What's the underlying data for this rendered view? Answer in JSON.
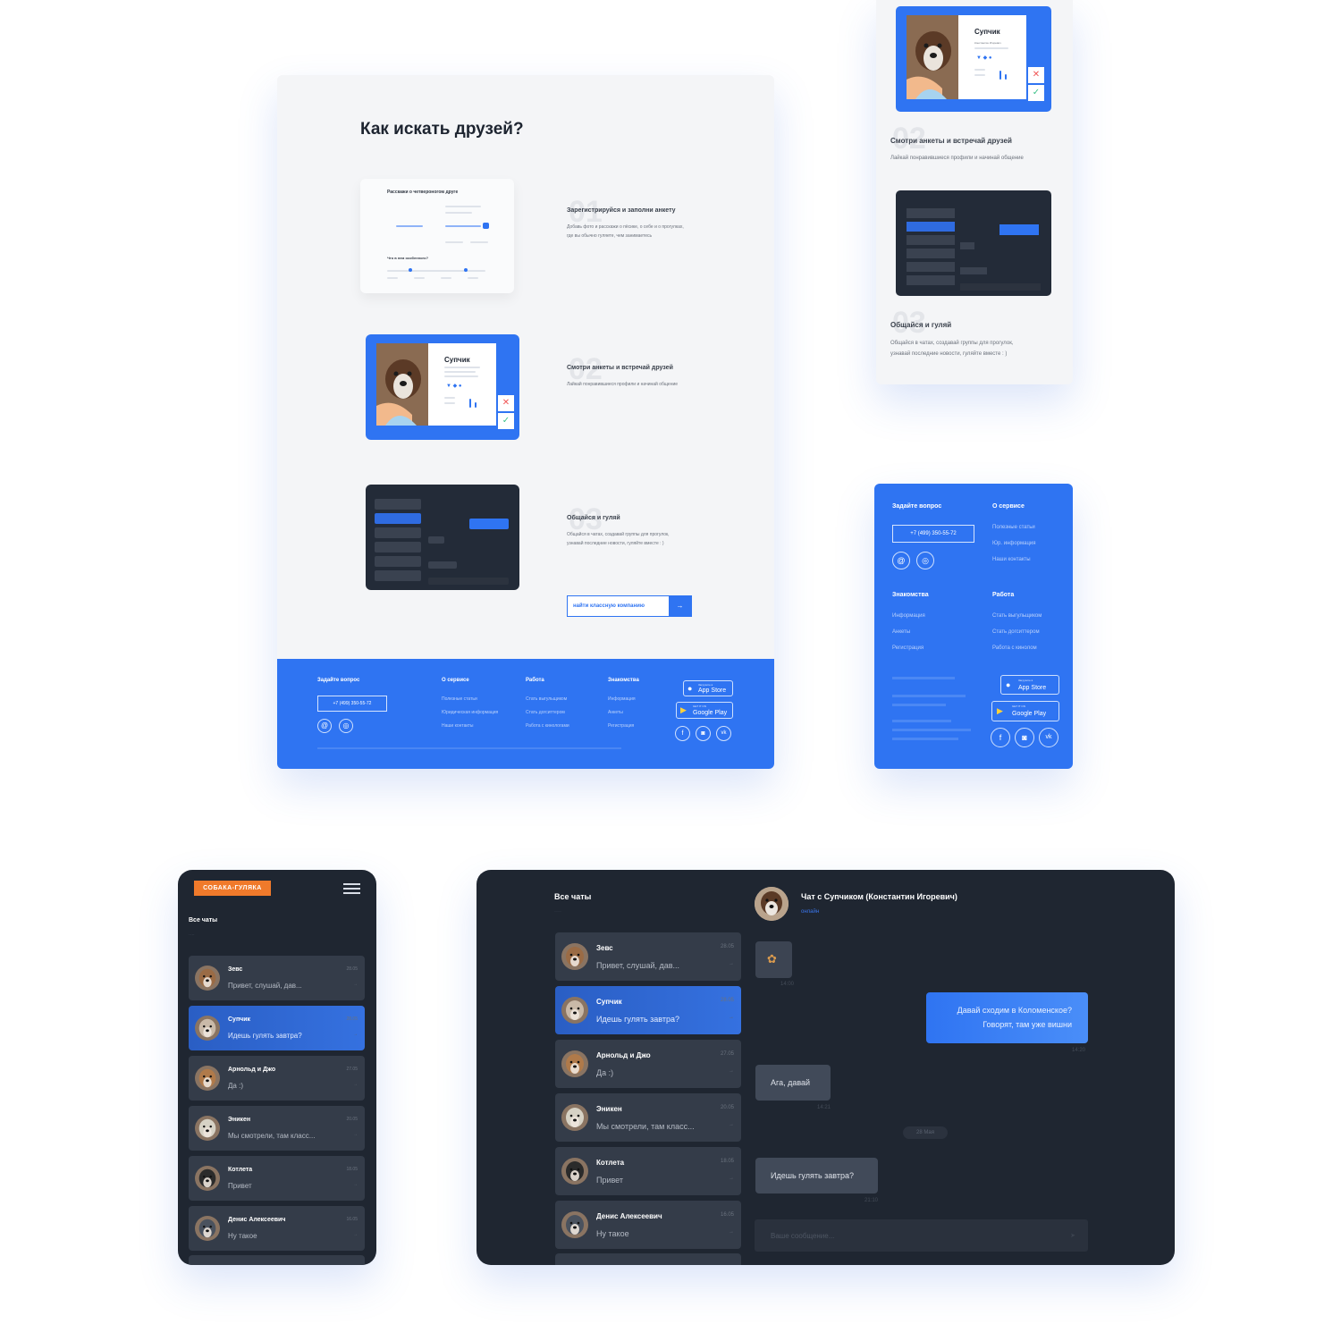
{
  "main_card": {
    "heading": "Как искать друзей?",
    "steps": [
      {
        "num": "01",
        "title": "Зарегистрируйся и заполни анкету",
        "desc": "Добавь фото и расскажи о пёсике, о себе и о прогулках, где вы обычно гуляете, чем занимаетесь",
        "thumb": {
          "title": "Расскажи о четвероногом друге",
          "subtitle": "Что в нем особенного?"
        }
      },
      {
        "num": "02",
        "title": "Смотри анкеты и встречай друзей",
        "desc": "Лайкай понравившиеся профили и начинай общение",
        "thumb": {
          "name": "Супчик"
        }
      },
      {
        "num": "03",
        "title": "Общайся и гуляй",
        "desc": "Общайся в чатах, создавай группы для прогулок, узнавай последние новости, гуляйте вместе : )"
      }
    ],
    "cta_label": "найти классную компанию",
    "cta_arrow": "→"
  },
  "footer": {
    "ask_title": "Задайте вопрос",
    "phone": "+7 (499) 350-55-72",
    "service_title": "О сервисе",
    "service_links": [
      "Полезные статьи",
      "Юридическая информация",
      "Наши контакты"
    ],
    "work_title": "Работа",
    "work_links": [
      "Стать выгульщиком",
      "Стать догситтером",
      "Работа с кинологами"
    ],
    "dating_title": "Знакомства",
    "dating_links": [
      "Информация",
      "Анкеты",
      "Регистрация"
    ],
    "app_store_small": "Загрузите в",
    "app_store": "App Store",
    "google_play_small": "GET IT ON",
    "google_play": "Google Play"
  },
  "right_column": {
    "step2_num": "02",
    "step2_title": "Смотри анкеты и встречай друзей",
    "step2_desc": "Лайкай понравившиеся профили и начинай общение",
    "step3_num": "03",
    "step3_title": "Общайся и гуляй",
    "step3_desc_1": "Общайся в чатах, создавай группы для прогулок,",
    "step3_desc_2": "узнавай последние новости, гуляйте вместе : )",
    "card_name": "Супчик",
    "card_sub": "Константин Игоревич"
  },
  "mobile_footer": {
    "ask_title": "Задайте вопрос",
    "phone": "+7 (499) 350-55-72",
    "service_title": "О сервисе",
    "service_links": [
      "Полезные статьи",
      "Юр. информация",
      "Наши контакты"
    ],
    "dating_title": "Знакомства",
    "dating_links": [
      "Информация",
      "Анкеты",
      "Регистрация"
    ],
    "work_title": "Работа",
    "work_links": [
      "Стать выгульщиком",
      "Стать догситтером",
      "Работа с кинолом"
    ],
    "app_store_small": "Загрузите в",
    "app_store": "App Store",
    "google_play_small": "GET IT ON",
    "google_play": "Google Play"
  },
  "mobile_chat": {
    "logo": "СОБАКА-ГУЛЯКА",
    "title": "Все чаты"
  },
  "chats": [
    {
      "name": "Зевс",
      "msg": "Привет, слушай, дав...",
      "date": "28.05",
      "active": false,
      "avatar": "#9a6b45"
    },
    {
      "name": "Супчик",
      "msg": "Идешь гулять завтра?",
      "date": "28.05",
      "active": true,
      "avatar": "#c9b9a8"
    },
    {
      "name": "Арнольд и Джо",
      "msg": "Да :)",
      "date": "27.05",
      "active": false,
      "avatar": "#b07a4a"
    },
    {
      "name": "Эникен",
      "msg": "Мы смотрели, там класс...",
      "date": "20.05",
      "active": false,
      "avatar": "#d6d2c5"
    },
    {
      "name": "Котлета",
      "msg": "Привет",
      "date": "18.05",
      "active": false,
      "avatar": "#2b2b2b"
    },
    {
      "name": "Денис Алексеевич",
      "msg": "Ну такое",
      "date": "16.05",
      "active": false,
      "avatar": "#4a525e"
    }
  ],
  "desktop_chat": {
    "title": "Все чаты",
    "chat_with": "Чат с Супчиком (Константин Игоревич)",
    "status": "онлайн",
    "messages": [
      {
        "dir": "out",
        "text_1": "Давай сходим в Коломенское?",
        "text_2": "Говорят, там уже вишни",
        "time": "14:20"
      },
      {
        "dir": "in",
        "text_1": "Ага, давай",
        "time": "14:21"
      },
      {
        "dir": "in",
        "text_1": "Идешь гулять завтра?",
        "time": "21:10"
      }
    ],
    "date_pill": "28 Мая",
    "sticker_time": "14:00",
    "input_placeholder": "Ваше сообщение..."
  },
  "colors": {
    "brand_blue": "#2f74f2",
    "brand_orange": "#f07a2b",
    "dark_bg": "#1f2631",
    "dark_item": "#343c49"
  }
}
